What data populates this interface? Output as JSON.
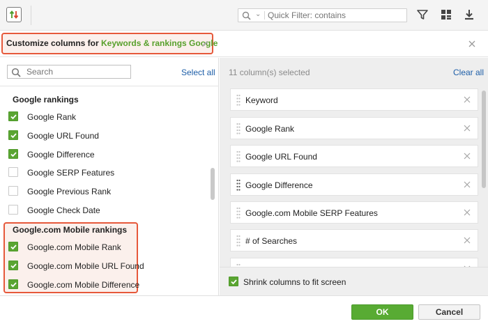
{
  "toolbar": {
    "app_icon": "rank-tracker-icon",
    "quick_filter_placeholder": "Quick Filter: contains",
    "buttons": [
      "filter-icon",
      "layout-icon",
      "download-icon"
    ]
  },
  "dialog": {
    "title_prefix": "Customize columns for ",
    "project_name": "Keywords & rankings Google",
    "accent": "#e6583a",
    "project_color": "#58a02c"
  },
  "left": {
    "search_placeholder": "Search",
    "select_all": "Select all",
    "groups": [
      {
        "title": "Google rankings",
        "items": [
          {
            "label": "Google Rank",
            "checked": true
          },
          {
            "label": "Google URL Found",
            "checked": true
          },
          {
            "label": "Google Difference",
            "checked": true
          },
          {
            "label": "Google SERP Features",
            "checked": false
          },
          {
            "label": "Google Previous Rank",
            "checked": false
          },
          {
            "label": "Google Check Date",
            "checked": false
          }
        ]
      },
      {
        "title": "Google.com Mobile rankings",
        "items": [
          {
            "label": "Google.com Mobile Rank",
            "checked": true
          },
          {
            "label": "Google.com Mobile URL Found",
            "checked": true
          },
          {
            "label": "Google.com Mobile Difference",
            "checked": true
          }
        ]
      }
    ]
  },
  "right": {
    "selected_count": "11 column(s) selected",
    "clear_all": "Clear all",
    "columns": [
      "Keyword",
      "Google Rank",
      "Google URL Found",
      "Google Difference",
      "Google.com Mobile SERP Features",
      "# of Searches"
    ],
    "shrink_label": "Shrink columns to fit screen",
    "shrink_checked": true
  },
  "footer": {
    "ok": "OK",
    "cancel": "Cancel"
  }
}
